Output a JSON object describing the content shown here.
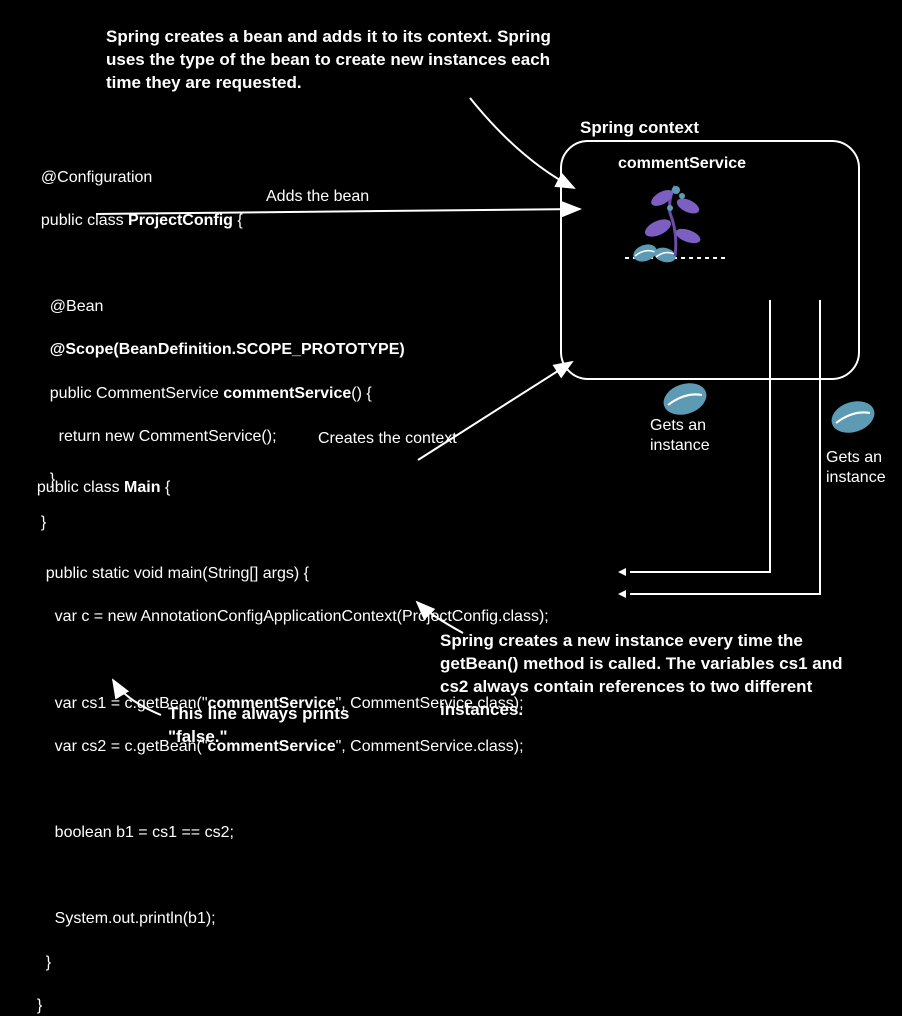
{
  "top_annotation": "Spring creates a bean and adds it to its context.\nSpring uses the type of the bean to create new\ninstances each time they are requested.",
  "context_title": "Spring context",
  "service_name": "commentService",
  "config_code_l1": "@Configuration",
  "config_code_l2_a": "public class ",
  "config_code_l2_b": "ProjectConfig",
  "config_code_l2_c": " {",
  "config_code_l3": "  @Bean",
  "config_code_l4": "  @Scope(BeanDefinition.SCOPE_PROTOTYPE)",
  "config_code_l5_a": "  public CommentService ",
  "config_code_l5_b": "commentService",
  "config_code_l5_c": "() {",
  "config_code_l6": "    return new CommentService();",
  "config_code_l7": "  }",
  "config_code_l8": "}",
  "adds_bean_label": "Adds the bean",
  "creates_context_label": "Creates the context",
  "gets_instance_label_1": "Gets an\ninstance",
  "gets_instance_label_2": "Gets an\ninstance",
  "main_code_l1_a": "public class ",
  "main_code_l1_b": "Main",
  "main_code_l1_c": " {",
  "main_code_l2": "  public static void main(String[] args) {",
  "main_code_l3": "    var c = new AnnotationConfigApplicationContext(ProjectConfig.class);",
  "main_code_l4_a": "    var cs1 = c.getBean(\"",
  "main_code_l4_b": "commentService",
  "main_code_l4_c": "\", CommentService.class);",
  "main_code_l5_a": "    var cs2 = c.getBean(\"",
  "main_code_l5_b": "commentService",
  "main_code_l5_c": "\", CommentService.class);",
  "main_code_l6": "    boolean b1 = cs1 == cs2;",
  "main_code_l7": "    System.out.println(b1);",
  "main_code_l8": "  }",
  "main_code_l9": "}",
  "bottom_right_annotation": "Spring creates a new instance every time the\ngetBean() method is called. The variables cs1\nand cs2 always contain references to two\ndifferent instances.",
  "bottom_left_annotation": "This line always\nprints \"false.\""
}
